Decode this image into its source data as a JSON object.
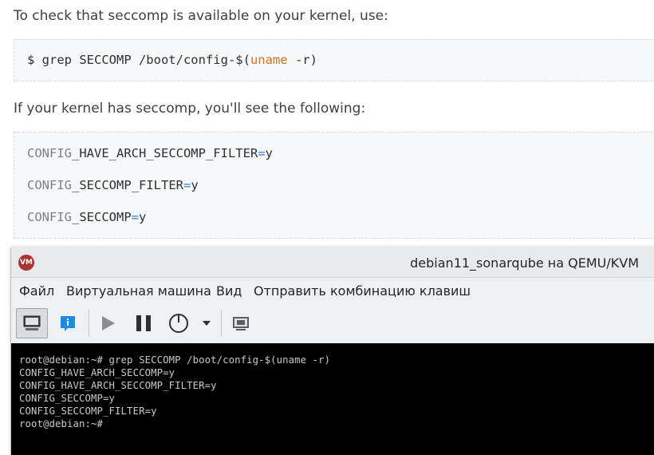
{
  "doc": {
    "intro1": "To check that seccomp is available on your kernel, use:",
    "cmd": {
      "prompt": "$ grep SECCOMP /boot/config-$(",
      "keyword": "uname",
      "rest": " -r)"
    },
    "intro2": "If your kernel has seccomp, you'll see the following:",
    "config_lines": [
      {
        "prefix": "CONFIG",
        "name": "_HAVE_ARCH_SECCOMP_FILTER",
        "eq": "=",
        "value": "y"
      },
      {
        "prefix": "CONFIG",
        "name": "_SECCOMP_FILTER",
        "eq": "=",
        "value": "y"
      },
      {
        "prefix": "CONFIG",
        "name": "_SECCOMP",
        "eq": "=",
        "value": "y"
      }
    ]
  },
  "vm": {
    "logo": "VM",
    "title": "debian11_sonarqube на QEMU/KVM",
    "menu": [
      "Файл",
      "Виртуальная машина",
      "Вид",
      "Отправить комбинацию клавиш"
    ],
    "toolbar": [
      {
        "icon": "console-icon",
        "active": true
      },
      {
        "icon": "info-icon",
        "active": false
      },
      {
        "icon": "play-icon",
        "active": false
      },
      {
        "icon": "pause-icon",
        "active": false
      },
      {
        "icon": "power-icon",
        "active": false
      },
      {
        "icon": "dropdown-arrow-icon",
        "active": false
      },
      {
        "icon": "screenshot-icon",
        "active": false
      }
    ],
    "terminal": [
      "root@debian:~# grep SECCOMP /boot/config-$(uname -r)",
      "CONFIG_HAVE_ARCH_SECCOMP=y",
      "CONFIG_HAVE_ARCH_SECCOMP_FILTER=y",
      "CONFIG_SECCOMP=y",
      "CONFIG_SECCOMP_FILTER=y",
      "root@debian:~#"
    ]
  },
  "colors": {
    "keyword": "#d3711e",
    "equals": "#2a7fd4",
    "info_icon": "#1e88e5"
  }
}
